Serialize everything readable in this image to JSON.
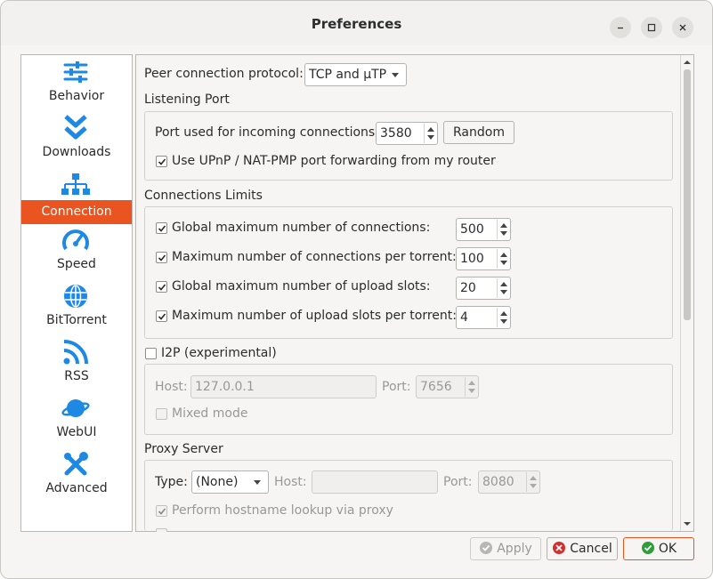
{
  "window": {
    "title": "Preferences"
  },
  "sidebar": {
    "items": [
      {
        "label": "Behavior",
        "icon": "sliders-icon"
      },
      {
        "label": "Downloads",
        "icon": "chevrons-down-icon"
      },
      {
        "label": "Connection",
        "icon": "network-icon"
      },
      {
        "label": "Speed",
        "icon": "speedometer-icon"
      },
      {
        "label": "BitTorrent",
        "icon": "globe-icon"
      },
      {
        "label": "RSS",
        "icon": "rss-icon"
      },
      {
        "label": "WebUI",
        "icon": "planet-icon"
      },
      {
        "label": "Advanced",
        "icon": "tools-icon"
      }
    ],
    "active": "Connection"
  },
  "connection": {
    "peer_protocol_label": "Peer connection protocol:",
    "peer_protocol_value": "TCP and µTP",
    "listening_port": {
      "title": "Listening Port",
      "port_label": "Port used for incoming connections:",
      "port_value": "3580",
      "random_button": "Random",
      "upnp_label": "Use UPnP / NAT-PMP port forwarding from my router"
    },
    "limits": {
      "title": "Connections Limits",
      "rows": [
        {
          "label": "Global maximum number of connections:",
          "value": "500"
        },
        {
          "label": "Maximum number of connections per torrent:",
          "value": "100"
        },
        {
          "label": "Global maximum number of upload slots:",
          "value": "20"
        },
        {
          "label": "Maximum number of upload slots per torrent:",
          "value": "4"
        }
      ]
    },
    "i2p": {
      "title": "I2P (experimental)",
      "host_label": "Host:",
      "host_value": "127.0.0.1",
      "port_label": "Port:",
      "port_value": "7656",
      "mixed_label": "Mixed mode"
    },
    "proxy": {
      "title": "Proxy Server",
      "type_label": "Type:",
      "type_value": "(None)",
      "host_label": "Host:",
      "host_value": "",
      "port_label": "Port:",
      "port_value": "8080",
      "hostname_lookup_label": "Perform hostname lookup via proxy"
    }
  },
  "footer": {
    "apply": "Apply",
    "cancel": "Cancel",
    "ok": "OK"
  },
  "colors": {
    "accent": "#e95420",
    "icon_blue": "#1e88e5"
  }
}
